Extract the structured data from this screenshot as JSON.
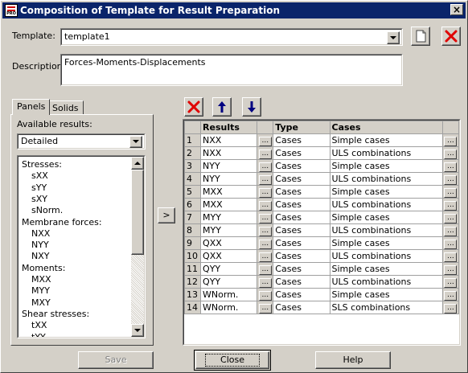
{
  "window": {
    "title": "Composition of Template for Result Preparation",
    "app_icon_text": "PRO"
  },
  "template": {
    "label": "Template:",
    "value": "template1"
  },
  "description": {
    "label": "Description:",
    "value": "Forces-Moments-Displacements"
  },
  "tabs": [
    {
      "label": "Panels",
      "selected": true
    },
    {
      "label": "Solids",
      "selected": false
    }
  ],
  "available": {
    "label": "Available results:",
    "selected": "Detailed"
  },
  "tree": [
    {
      "label": "Stresses:",
      "level": 0
    },
    {
      "label": "sXX",
      "level": 1
    },
    {
      "label": "sYY",
      "level": 1
    },
    {
      "label": "sXY",
      "level": 1
    },
    {
      "label": "sNorm.",
      "level": 1
    },
    {
      "label": "Membrane forces:",
      "level": 0
    },
    {
      "label": "NXX",
      "level": 1
    },
    {
      "label": "NYY",
      "level": 1
    },
    {
      "label": "NXY",
      "level": 1
    },
    {
      "label": "Moments:",
      "level": 0
    },
    {
      "label": "MXX",
      "level": 1
    },
    {
      "label": "MYY",
      "level": 1
    },
    {
      "label": "MXY",
      "level": 1
    },
    {
      "label": "Shear stresses:",
      "level": 0
    },
    {
      "label": "tXX",
      "level": 1
    },
    {
      "label": "tYY",
      "level": 1
    }
  ],
  "move_button": {
    "label": ">"
  },
  "grid": {
    "headers": [
      "",
      "Results",
      "",
      "Type",
      "Cases",
      ""
    ],
    "ellipsis": "...",
    "rows": [
      {
        "n": "1",
        "result": "NXX",
        "type": "Cases",
        "cases": "Simple cases"
      },
      {
        "n": "2",
        "result": "NXX",
        "type": "Cases",
        "cases": "ULS combinations"
      },
      {
        "n": "3",
        "result": "NYY",
        "type": "Cases",
        "cases": "Simple cases"
      },
      {
        "n": "4",
        "result": "NYY",
        "type": "Cases",
        "cases": "ULS combinations"
      },
      {
        "n": "5",
        "result": "MXX",
        "type": "Cases",
        "cases": "Simple cases"
      },
      {
        "n": "6",
        "result": "MXX",
        "type": "Cases",
        "cases": "ULS combinations"
      },
      {
        "n": "7",
        "result": "MYY",
        "type": "Cases",
        "cases": "Simple cases"
      },
      {
        "n": "8",
        "result": "MYY",
        "type": "Cases",
        "cases": "ULS combinations"
      },
      {
        "n": "9",
        "result": "QXX",
        "type": "Cases",
        "cases": "Simple cases"
      },
      {
        "n": "10",
        "result": "QXX",
        "type": "Cases",
        "cases": "ULS combinations"
      },
      {
        "n": "11",
        "result": "QYY",
        "type": "Cases",
        "cases": "Simple cases"
      },
      {
        "n": "12",
        "result": "QYY",
        "type": "Cases",
        "cases": "ULS combinations"
      },
      {
        "n": "13",
        "result": "WNorm.",
        "type": "Cases",
        "cases": "Simple cases"
      },
      {
        "n": "14",
        "result": "WNorm.",
        "type": "Cases",
        "cases": "SLS combinations"
      }
    ]
  },
  "buttons": {
    "save": "Save",
    "close": "Close",
    "help": "Help"
  },
  "colors": {
    "titlebar": "#0a246a",
    "delete_red": "#e00000",
    "arrow_blue": "#000080"
  }
}
